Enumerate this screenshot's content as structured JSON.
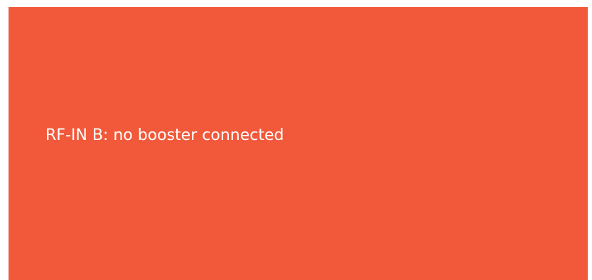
{
  "status_panel": {
    "message": "RF-IN B: no booster connected",
    "background_color": "#f1593a",
    "text_color": "#ffffff"
  }
}
